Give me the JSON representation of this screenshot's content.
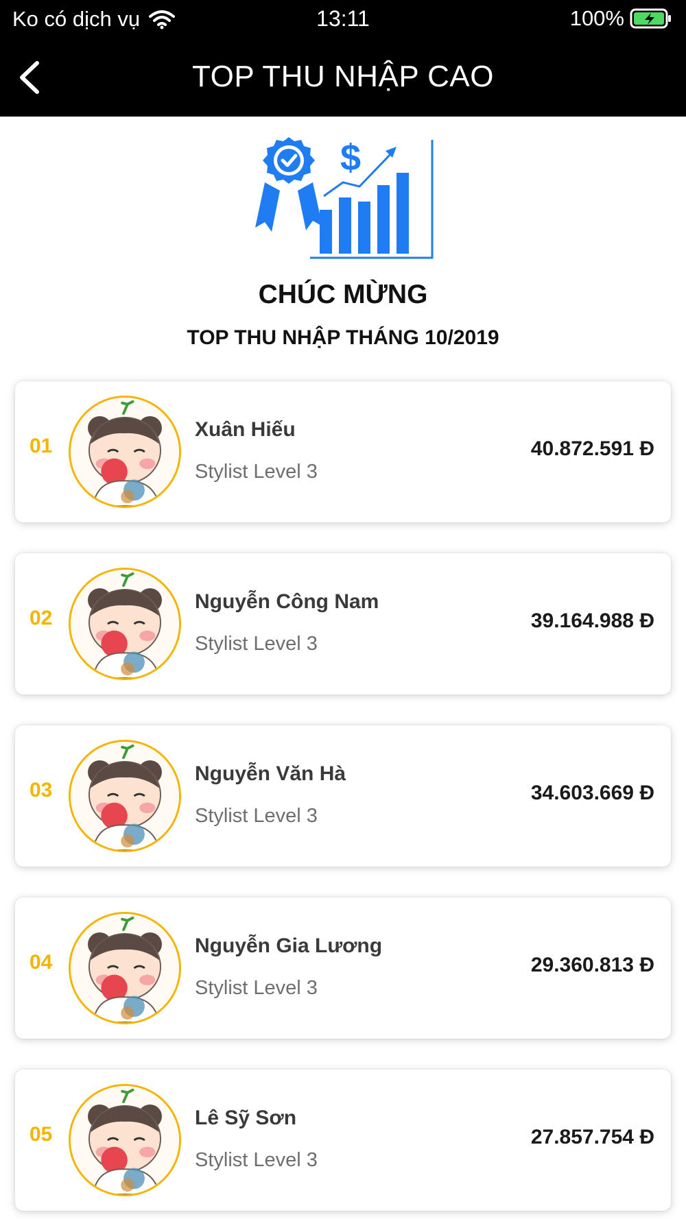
{
  "status_bar": {
    "carrier": "Ko có dịch vụ",
    "time": "13:11",
    "battery": "100%"
  },
  "nav": {
    "title": "TOP THU NHẬP CAO"
  },
  "hero": {
    "icon": "award-chart-icon",
    "title": "CHÚC MỪNG",
    "subtitle": "TOP THU NHẬP THÁNG 10/2019"
  },
  "colors": {
    "accent": "#f5b400",
    "hero_blue": "#1f7cf2",
    "header_bg": "#000000"
  },
  "ranking": [
    {
      "rank": "01",
      "name": "Xuân Hiếu",
      "level": "Stylist Level 3",
      "amount": "40.872.591 Đ"
    },
    {
      "rank": "02",
      "name": "Nguyễn Công Nam",
      "level": "Stylist Level 3",
      "amount": "39.164.988 Đ"
    },
    {
      "rank": "03",
      "name": "Nguyễn Văn Hà",
      "level": "Stylist Level 3",
      "amount": "34.603.669 Đ"
    },
    {
      "rank": "04",
      "name": "Nguyễn Gia Lương",
      "level": "Stylist Level 3",
      "amount": "29.360.813 Đ"
    },
    {
      "rank": "05",
      "name": "Lê Sỹ Sơn",
      "level": "Stylist Level 3",
      "amount": "27.857.754 Đ"
    }
  ]
}
